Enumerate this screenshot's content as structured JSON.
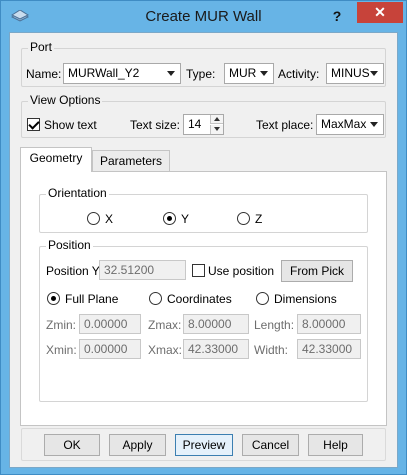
{
  "window": {
    "title": "Create MUR Wall",
    "help_label": "?",
    "close_label": "✕"
  },
  "port": {
    "group_title": "Port",
    "name_label": "Name:",
    "name_value": "MURWall_Y2",
    "type_label": "Type:",
    "type_value": "MUR",
    "activity_label": "Activity:",
    "activity_value": "MINUS"
  },
  "view_options": {
    "group_title": "View Options",
    "show_text_label": "Show text",
    "show_text_checked": true,
    "text_size_label": "Text size:",
    "text_size_value": "14",
    "text_place_label": "Text place:",
    "text_place_value": "MaxMax"
  },
  "tabs": [
    {
      "label": "Geometry",
      "active": true
    },
    {
      "label": "Parameters",
      "active": false
    }
  ],
  "orientation": {
    "group_title": "Orientation",
    "options": [
      {
        "label": "X",
        "selected": false
      },
      {
        "label": "Y",
        "selected": true
      },
      {
        "label": "Z",
        "selected": false
      }
    ]
  },
  "position": {
    "group_title": "Position",
    "position_label": "Position Y",
    "position_value": "32.51200",
    "use_position_label": "Use position",
    "use_position_checked": false,
    "from_pick_label": "From Pick",
    "modes": [
      {
        "label": "Full Plane",
        "selected": true
      },
      {
        "label": "Coordinates",
        "selected": false
      },
      {
        "label": "Dimensions",
        "selected": false
      }
    ],
    "zmin_label": "Zmin:",
    "zmin_value": "0.00000",
    "zmax_label": "Zmax:",
    "zmax_value": "8.00000",
    "length_label": "Length:",
    "length_value": "8.00000",
    "xmin_label": "Xmin:",
    "xmin_value": "0.00000",
    "xmax_label": "Xmax:",
    "xmax_value": "42.33000",
    "width_label": "Width:",
    "width_value": "42.33000"
  },
  "buttons": {
    "ok": "OK",
    "apply": "Apply",
    "preview": "Preview",
    "cancel": "Cancel",
    "help": "Help"
  },
  "colors": {
    "titlebar": "#67b4e6",
    "close": "#c7433a",
    "dialog_bg": "#f0f0f0"
  }
}
